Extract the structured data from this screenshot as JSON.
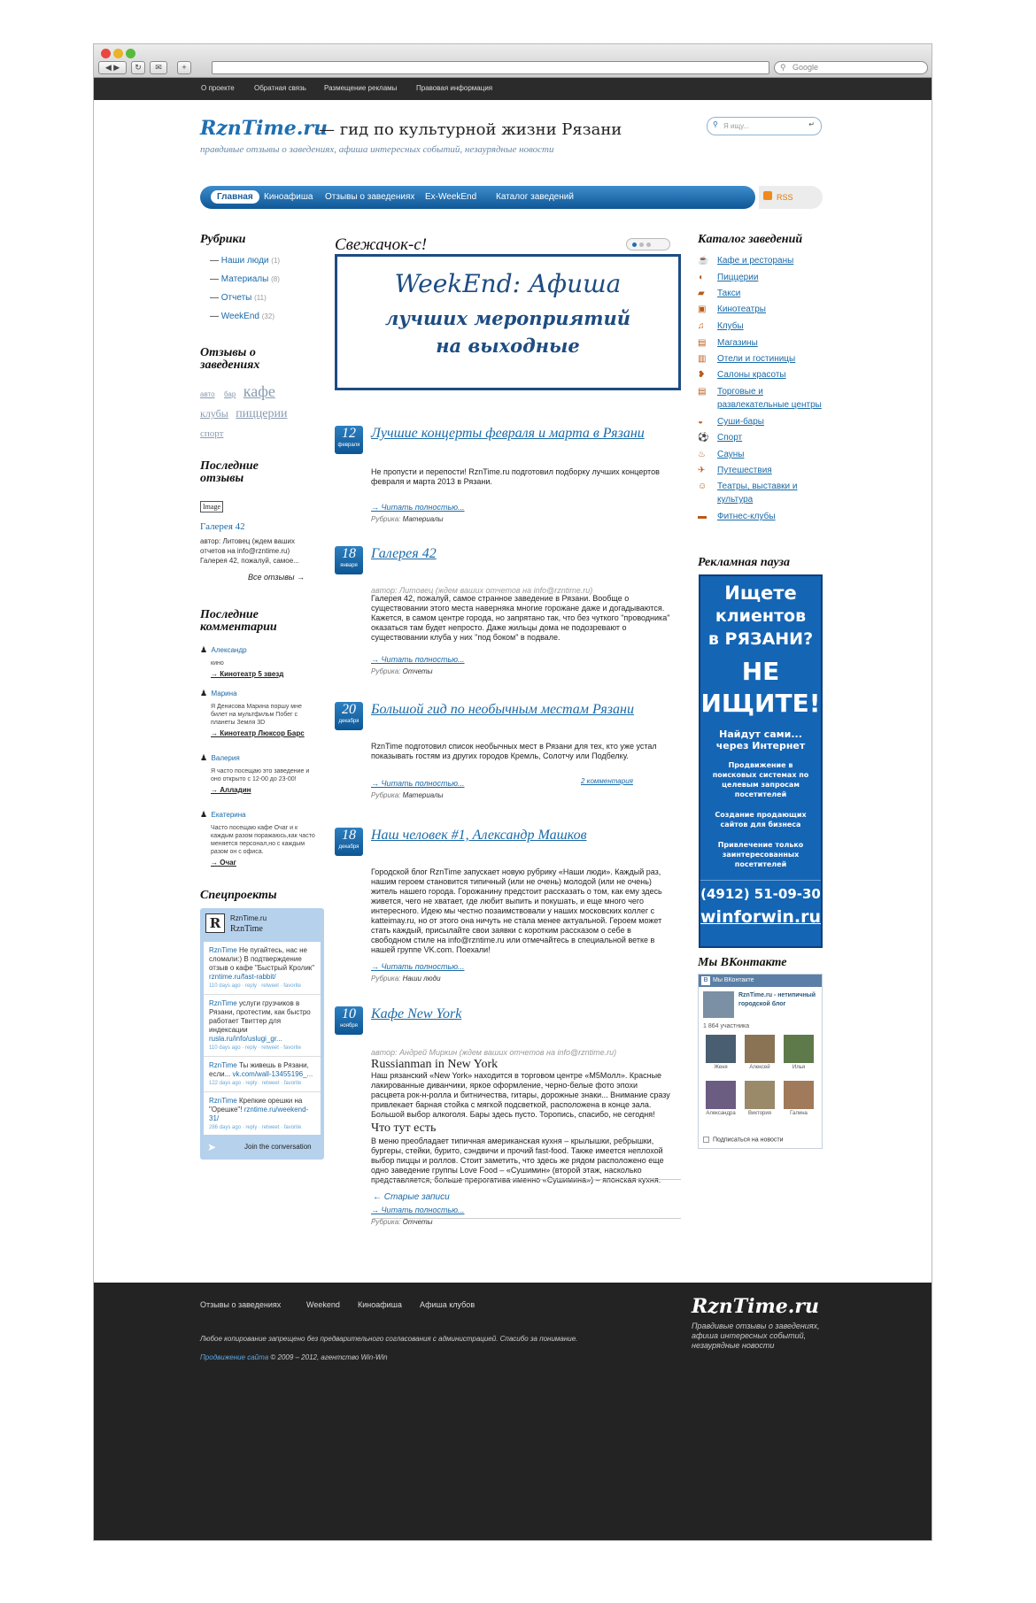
{
  "browser": {
    "google_placeholder": "Google"
  },
  "topnav": [
    "О проекте",
    "Обратная связь",
    "Размещение рекламы",
    "Правовая информация"
  ],
  "header": {
    "logo": "RznTime.ru",
    "tagline": "— гид по культурной жизни Рязани",
    "subtitle": "правдивые отзывы о заведениях, афиша интересных событий, незаурядные новости",
    "search_placeholder": "Я ищу..."
  },
  "menu": {
    "items": [
      "Главная",
      "Киноафиша",
      "Отзывы о заведениях",
      "Ex-WeekEnd",
      "Каталог заведений"
    ],
    "rss": "RSS"
  },
  "left": {
    "rubrics_title": "Рубрики",
    "rubrics": [
      {
        "label": "Наши люди",
        "count": "(1)"
      },
      {
        "label": "Материалы",
        "count": "(8)"
      },
      {
        "label": "Отчеты",
        "count": "(11)"
      },
      {
        "label": "WeekEnd",
        "count": "(32)"
      }
    ],
    "tags_title": "Отзывы о заведениях",
    "tags": [
      "авто",
      "бар",
      "кафе",
      "клубы",
      "пиццерии",
      "спорт"
    ],
    "reviews_title": "Последние отзывы",
    "review_image": "Image",
    "review_place": "Галерея 42",
    "review_text": "автор: Литовец (ждем ваших отчетов на info@rzntime.ru) Галерея 42, пожалуй, самое...",
    "review_all": "Все отзывы →",
    "comments_title": "Последние комментарии",
    "comments": [
      {
        "name": "Александр",
        "text": "кино",
        "target": "→ Кинотеатр 5 звезд"
      },
      {
        "name": "Марина",
        "text": "Я Денисова Марина поршу мне билет на мультфильм Побег с планеты Земля 3D",
        "target": "→ Кинотеатр Люксор Барс"
      },
      {
        "name": "Валерия",
        "text": "Я часто посещаю это заведение и оно открыто с 12-00 до 23-00!",
        "target": "→ Алладин"
      },
      {
        "name": "Екатерина",
        "text": "Часто посещаю кафе Очаг и к каждым разом поражаюсь,как часто меняется персонал,но с каждым разом он с офиса.",
        "target": "→ Очаг"
      }
    ],
    "special_title": "Спецпроекты",
    "twitter": {
      "site": "RznTime.ru",
      "handle": "RznTime",
      "footer": "Join the conversation",
      "tweets": [
        {
          "user": "RznTime",
          "text": "Не пугайтесь, нас не сломали:) В подтверждение отзыв о кафе \"Быстрый Кролик\"",
          "link": "rzntime.ru/fast-rabbit/",
          "meta": "110 days ago · reply · retweet · favorite"
        },
        {
          "user": "RznTime",
          "text": "услуги грузчиков в Рязани, протестим, как быстро работает Твиттер для индексации",
          "link": "rusla.ru/info/uslugi_gr...",
          "meta": "110 days ago · reply · retweet · favorite"
        },
        {
          "user": "RznTime",
          "text": "Ты живешь в Рязани, если...",
          "link": "vk.com/wall-13455196_...",
          "meta": "122 days ago · reply · retweet · favorite"
        },
        {
          "user": "RznTime",
          "text": "Крепкие орешки на \"Орешке\"!",
          "link": "rzntime.ru/weekend-31/",
          "meta": "286 days ago · reply · retweet · favorite"
        }
      ]
    }
  },
  "center": {
    "slider_title": "Свежачок-с!",
    "banner_line1": "WeekEnd: Афиша",
    "banner_line2": "лучших мероприятий",
    "banner_line3": "на выходные",
    "more": "→ Читать полностью...",
    "rubric_label": "Рубрика:",
    "older": "← Старые записи",
    "posts": [
      {
        "day": "12",
        "month": "февраля",
        "title": "Лучшие концерты февраля и марта в Рязани",
        "author": "",
        "body": "Не пропусти и перепости! RznTime.ru подготовил подборку лучших концертов февраля и марта 2013 в Рязани.",
        "rubric": "Материалы",
        "comments": ""
      },
      {
        "day": "18",
        "month": "января",
        "title": "Галерея 42",
        "author": "автор: Литовец (ждем ваших отчетов на info@rzntime.ru)",
        "body": "Галерея 42, пожалуй, самое странное заведение в Рязани. Вообще о существовании этого места наверняка многие горожане даже и догадываются. Кажется, в самом центре города, но запрятано так, что без чуткого \"проводника\" оказаться там будет непросто. Даже жильцы дома не подозревают о существовании клуба у них \"под боком\" в подвале.",
        "rubric": "Отчеты",
        "comments": ""
      },
      {
        "day": "20",
        "month": "декабря",
        "title": "Большой гид по необычным местам Рязани",
        "author": "",
        "body": "RznTime подготовил список необычных мест в Рязани для тех, кто уже устал показывать гостям из других городов Кремль, Солотчу или Подбелку.",
        "rubric": "Материалы",
        "comments": "2 комментария"
      },
      {
        "day": "18",
        "month": "декабря",
        "title": "Наш человек #1, Александр Машков",
        "author": "",
        "body": "Городской блог RznTime запускает новую рубрику «Наши люди». Каждый раз, нашим героем становится типичный (или не очень) молодой (или не очень) житель нашего города. Горожанину предстоит рассказать о том, как ему здесь живется, чего не хватает, где любит выпить и покушать, и еще много чего интересного. Идею мы честно позаимствовали у наших московских коллег с katteimay.ru, но от этого она ничуть не стала менее актуальной. Героем может стать каждый, присылайте свои заявки с коротким рассказом о себе в свободном стиле на info@rzntime.ru или отмечайтесь в специальной ветке в нашей группе VK.com. Поехали!",
        "rubric": "Наши люди",
        "comments": ""
      },
      {
        "day": "10",
        "month": "ноября",
        "title": "Кафе New York",
        "author": "автор: Андрей Миркин (ждем ваших отчетов на info@rzntime.ru)",
        "sub1": "Russianman in New York",
        "body": "Наш рязанский «New York» находится в торговом центре «М5Молл». Красные лакированные диванчики, яркое оформление, черно-белые фото эпохи расцвета рок-н-ролла и битничества, гитары, дорожные знаки... Внимание сразу привлекает барная стойка с мягкой подсветкой, расположена в конце зала. Большой выбор алкоголя. Бары здесь пусто. Торопись, спасибо, не сегодня!",
        "sub2": "Что тут есть",
        "body2": "В меню преобладает типичная американская кухня – крылышки, ребрышки, бургеры, стейки, бурито, сэндвичи и прочий fast-food. Также имеется неплохой выбор пиццы и роллов. Стоит заметить, что здесь же рядом расположено еще одно заведение группы Love Food – «Сушимин» (второй этаж, насколько представляется, больше прерогатива именно «Сушимина») – японская кухня.",
        "rubric": "Отчеты",
        "comments": ""
      }
    ]
  },
  "right": {
    "catalog_title": "Каталог заведений",
    "catalog": [
      {
        "label": "Кафе и рестораны",
        "icon": "coffee-icon",
        "sym": "☕"
      },
      {
        "label": "Пиццерии",
        "icon": "pizza-icon",
        "sym": "◖"
      },
      {
        "label": "Такси",
        "icon": "taxi-icon",
        "sym": "▰"
      },
      {
        "label": "Кинотеатры",
        "icon": "film-icon",
        "sym": "▣"
      },
      {
        "label": "Клубы",
        "icon": "music-icon",
        "sym": "♫"
      },
      {
        "label": "Магазины",
        "icon": "shop-icon",
        "sym": "▤"
      },
      {
        "label": "Отели и гостиницы",
        "icon": "hotel-icon",
        "sym": "▥"
      },
      {
        "label": "Салоны красоты",
        "icon": "lips-icon",
        "sym": "❥"
      },
      {
        "label": "Торговые и развлекательные центры",
        "icon": "mall-icon",
        "sym": "▤"
      },
      {
        "label": "Суши-бары",
        "icon": "sushi-icon",
        "sym": "◒"
      },
      {
        "label": "Спорт",
        "icon": "ball-icon",
        "sym": "⚽"
      },
      {
        "label": "Сауны",
        "icon": "sauna-icon",
        "sym": "♨"
      },
      {
        "label": "Путешествия",
        "icon": "plane-icon",
        "sym": "✈"
      },
      {
        "label": "Театры, выставки и культура",
        "icon": "theatre-icon",
        "sym": "☺"
      },
      {
        "label": "Фитнес-клубы",
        "icon": "dumbbell-icon",
        "sym": "▬"
      }
    ],
    "ad_title": "Рекламная пауза",
    "ad": {
      "l1": "Ищете",
      "l2": "клиентов",
      "l3": "в РЯЗАНИ?",
      "l4": "НЕ",
      "l5": "ИЩИТЕ!",
      "l6": "Найдут сами...",
      "l7": "через Интернет",
      "l8": "Продвижение в поисковых системах по целевым запросам посетителей",
      "l9": "Создание продающих сайтов для бизнеса",
      "l10": "Привлечение только заинтересованных посетителей",
      "phone": "(4912) 51-09-30",
      "site": "winforwin.ru"
    },
    "vk_title": "Мы ВКонтакте",
    "vk": {
      "header": "Мы ВКонтакте",
      "group": "RznTime.ru - нетипичный городской блог",
      "members": "1 864 участника",
      "people": [
        "Женя",
        "Алексей",
        "Илья",
        "Александра",
        "Виктория",
        "Галина"
      ],
      "subscribe": "Подписаться на новости"
    }
  },
  "footer": {
    "links": [
      "Отзывы о заведениях",
      "Weekend",
      "Киноафиша",
      "Афиша клубов"
    ],
    "copy": "Любое копирование запрещено без предварительного согласования с администрацией. Спасибо за понимание.",
    "promo_link": "Продвижение сайта",
    "promo_rest": "© 2009 – 2012, агентство Win-Win",
    "logo": "RznTime.ru",
    "slogan": "Правдивые отзывы о заведениях, афиша интересных событий, незаурядные новости"
  }
}
